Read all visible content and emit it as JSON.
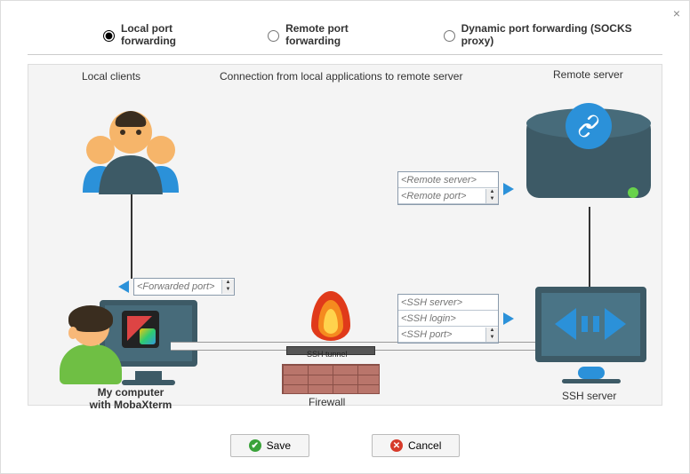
{
  "radios": {
    "local": "Local port forwarding",
    "remote": "Remote port forwarding",
    "dynamic": "Dynamic port forwarding (SOCKS proxy)",
    "selected": "local"
  },
  "labels": {
    "local_clients": "Local clients",
    "connection": "Connection from local applications to remote server",
    "remote_server": "Remote server",
    "my_computer_l1": "My computer",
    "my_computer_l2": "with MobaXterm",
    "firewall": "Firewall",
    "ssh_server": "SSH server",
    "ssh_tunnel": "SSH tunnel"
  },
  "fields": {
    "forwarded_port": "<Forwarded port>",
    "remote_server": "<Remote server>",
    "remote_port": "<Remote port>",
    "ssh_server": "<SSH server>",
    "ssh_login": "<SSH login>",
    "ssh_port": "<SSH port>"
  },
  "buttons": {
    "save": "Save",
    "cancel": "Cancel"
  }
}
